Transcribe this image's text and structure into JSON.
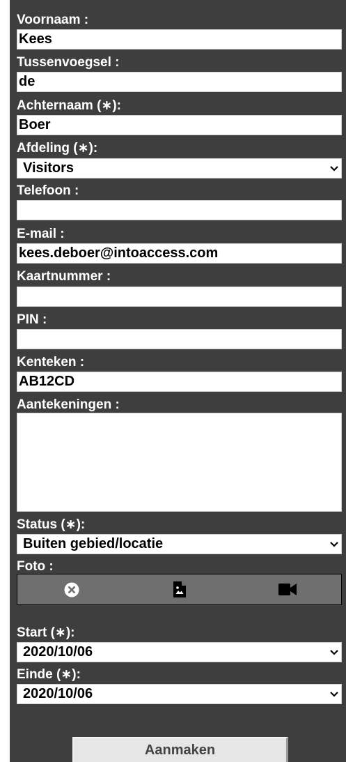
{
  "form": {
    "first_name": {
      "label": "Voornaam :",
      "value": "Kees"
    },
    "infix": {
      "label": "Tussenvoegsel :",
      "value": "de"
    },
    "last_name": {
      "label": "Achternaam (∗):",
      "value": "Boer"
    },
    "department": {
      "label": "Afdeling (∗):",
      "value": "Visitors"
    },
    "phone": {
      "label": "Telefoon :",
      "value": ""
    },
    "email": {
      "label": "E-mail :",
      "value": "kees.deboer@intoaccess.com"
    },
    "card_number": {
      "label": "Kaartnummer :",
      "value": ""
    },
    "pin": {
      "label": "PIN :",
      "value": ""
    },
    "license_plate": {
      "label": "Kenteken :",
      "value": "AB12CD"
    },
    "notes": {
      "label": "Aantekeningen :",
      "value": ""
    },
    "status": {
      "label": "Status (∗):",
      "value": "Buiten gebied/locatie"
    },
    "photo": {
      "label": "Foto :",
      "icons": [
        "clear-circle-icon",
        "upload-file-icon",
        "video-camera-icon"
      ]
    },
    "start": {
      "label": "Start (∗):",
      "value": "2020/10/06"
    },
    "end": {
      "label": "Einde (∗):",
      "value": "2020/10/06"
    },
    "submit_label": "Aanmaken"
  },
  "colors": {
    "panel_bg": "#3e3e3e",
    "photobar_bg": "#6f6f6f",
    "button_bg": "#e6e6e6"
  }
}
